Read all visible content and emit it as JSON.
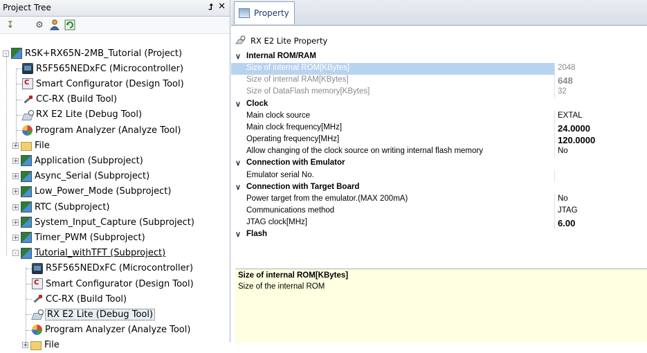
{
  "left_panel": {
    "title": "Project Tree",
    "pin_glyph": "⮥",
    "close_glyph": "✕",
    "toolbar_icons": [
      "sort-icon",
      "settings-icon",
      "user-icon",
      "refresh-icon"
    ],
    "tree": [
      {
        "label": "RSK+RX65N-2MB_Tutorial (Project)",
        "icon": "project-icon",
        "expander": "-"
      },
      {
        "label": "R5F565NEDxFC (Microcontroller)",
        "icon": "microcontroller-icon"
      },
      {
        "label": "Smart Configurator (Design Tool)",
        "icon": "smart-configurator-icon"
      },
      {
        "label": "CC-RX (Build Tool)",
        "icon": "build-tool-icon"
      },
      {
        "label": "RX E2 Lite (Debug Tool)",
        "icon": "debug-tool-icon"
      },
      {
        "label": "Program Analyzer (Analyze Tool)",
        "icon": "analyzer-icon"
      },
      {
        "label": "File",
        "icon": "folder-icon",
        "expander": "+"
      },
      {
        "label": "Application (Subproject)",
        "icon": "subproject-icon",
        "expander": "+"
      },
      {
        "label": "Async_Serial (Subproject)",
        "icon": "subproject-icon",
        "expander": "+"
      },
      {
        "label": "Low_Power_Mode (Subproject)",
        "icon": "subproject-icon",
        "expander": "+"
      },
      {
        "label": "RTC (Subproject)",
        "icon": "subproject-icon",
        "expander": "+"
      },
      {
        "label": "System_Input_Capture (Subproject)",
        "icon": "subproject-icon",
        "expander": "+"
      },
      {
        "label": "Timer_PWM (Subproject)",
        "icon": "subproject-icon",
        "expander": "+"
      },
      {
        "label": "Tutorial_withTFT (Subproject)",
        "icon": "subproject-icon",
        "expander": "-"
      },
      {
        "label": "R5F565NEDxFC (Microcontroller)",
        "icon": "microcontroller-icon"
      },
      {
        "label": "Smart Configurator (Design Tool)",
        "icon": "smart-configurator-icon"
      },
      {
        "label": "CC-RX (Build Tool)",
        "icon": "build-tool-icon"
      },
      {
        "label": "RX E2 Lite (Debug Tool)",
        "icon": "debug-tool-icon"
      },
      {
        "label": "Program Analyzer (Analyze Tool)",
        "icon": "analyzer-icon"
      },
      {
        "label": "File",
        "icon": "folder-icon",
        "expander": "+"
      }
    ]
  },
  "right_panel": {
    "tab_label": "Property",
    "property_title": "RX E2 Lite Property",
    "categories": [
      {
        "name": "Internal ROM/RAM",
        "rows": [
          {
            "name": "Size of internal ROM[KBytes]",
            "value": "2048",
            "style": "gray"
          },
          {
            "name": "Size of internal RAM[KBytes]",
            "value": "648",
            "style": "gray-bold"
          },
          {
            "name": "Size of DataFlash memory[KBytes]",
            "value": "32",
            "style": "gray"
          }
        ]
      },
      {
        "name": "Clock",
        "rows": [
          {
            "name": "Main clock source",
            "value": "EXTAL",
            "style": "normal"
          },
          {
            "name": "Main clock frequency[MHz]",
            "value": "24.0000",
            "style": "bold"
          },
          {
            "name": "Operating frequency[MHz]",
            "value": "120.0000",
            "style": "bold"
          },
          {
            "name": "Allow changing of the clock source on writing internal flash memory",
            "value": "No",
            "style": "normal"
          }
        ]
      },
      {
        "name": "Connection with Emulator",
        "rows": [
          {
            "name": "Emulator serial No.",
            "value": "",
            "style": "normal"
          }
        ]
      },
      {
        "name": "Connection with Target Board",
        "rows": [
          {
            "name": "Power target from the emulator.(MAX 200mA)",
            "value": "No",
            "style": "normal"
          },
          {
            "name": "Communications method",
            "value": "JTAG",
            "style": "normal"
          },
          {
            "name": "JTAG clock[MHz]",
            "value": "6.00",
            "style": "bold"
          }
        ]
      },
      {
        "name": "Flash",
        "rows": []
      }
    ],
    "description": {
      "title": "Size of internal ROM[KBytes]",
      "text": "Size of the internal ROM"
    }
  }
}
